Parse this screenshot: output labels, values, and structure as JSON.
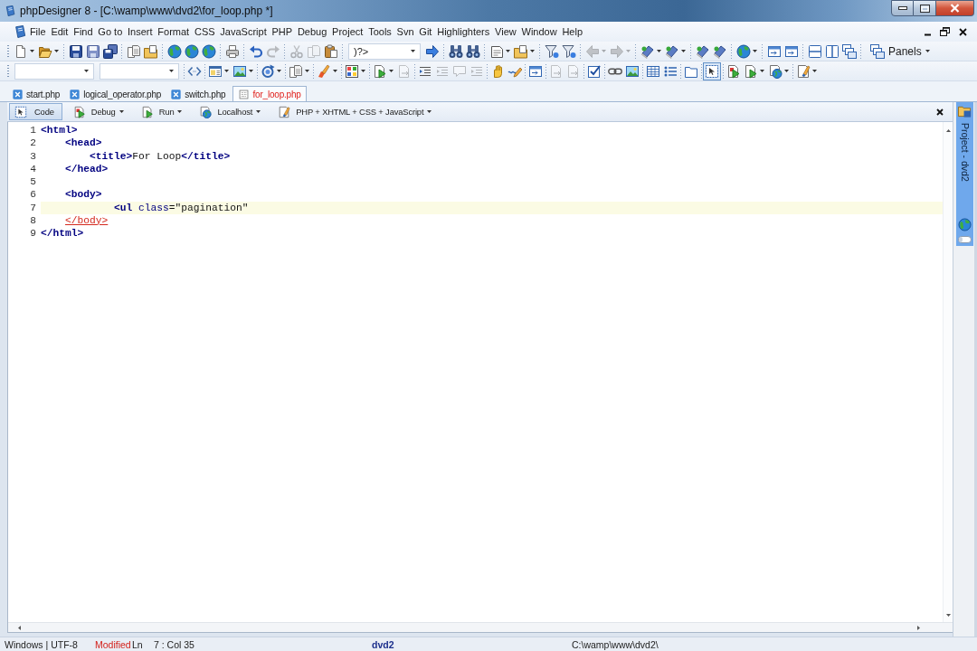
{
  "window": {
    "title": "phpDesigner 8 - [C:\\wamp\\www\\dvd2\\for_loop.php *]"
  },
  "menu_bar": {
    "items": [
      "File",
      "Edit",
      "Find",
      "Go to",
      "Insert",
      "Format",
      "CSS",
      "JavaScript",
      "PHP",
      "Debug",
      "Project",
      "Tools",
      "Svn",
      "Git",
      "Highlighters",
      "View",
      "Window",
      "Help"
    ]
  },
  "toolbar_1": [
    {
      "kind": "new",
      "menu": true,
      "disabled": false
    },
    {
      "kind": "open",
      "menu": true,
      "disabled": false
    },
    {
      "kind": "separator"
    },
    {
      "kind": "save",
      "menu": false,
      "disabled": false
    },
    {
      "kind": "savecopy",
      "menu": false,
      "disabled": false
    },
    {
      "kind": "saveall",
      "menu": false,
      "disabled": false
    },
    {
      "kind": "separator"
    },
    {
      "kind": "pages",
      "menu": false,
      "disabled": false
    },
    {
      "kind": "folderpage",
      "menu": false,
      "disabled": false
    },
    {
      "kind": "separator"
    },
    {
      "kind": "globe",
      "menu": false,
      "disabled": false
    },
    {
      "kind": "globe",
      "menu": false,
      "disabled": false
    },
    {
      "kind": "globe",
      "menu": false,
      "disabled": false
    },
    {
      "kind": "separator"
    },
    {
      "kind": "print",
      "menu": false,
      "disabled": false
    },
    {
      "kind": "separator"
    },
    {
      "kind": "undo",
      "menu": false,
      "disabled": false
    },
    {
      "kind": "redo",
      "menu": false,
      "disabled": true
    },
    {
      "kind": "separator"
    },
    {
      "kind": "cut",
      "menu": false,
      "disabled": true
    },
    {
      "kind": "copy",
      "menu": false,
      "disabled": true
    },
    {
      "kind": "paste",
      "menu": false,
      "disabled": false
    },
    {
      "kind": "separator"
    },
    {
      "kind": "combo",
      "value": ")?>"
    },
    {
      "kind": "arrow",
      "menu": false,
      "disabled": false
    },
    {
      "kind": "separator"
    },
    {
      "kind": "binoculars",
      "menu": false,
      "disabled": false
    },
    {
      "kind": "binoculars",
      "menu": false,
      "disabled": false
    },
    {
      "kind": "separator"
    },
    {
      "kind": "note",
      "menu": true,
      "disabled": false
    },
    {
      "kind": "folderpage",
      "menu": true,
      "disabled": false
    },
    {
      "kind": "separator"
    },
    {
      "kind": "filter",
      "menu": false,
      "disabled": false
    },
    {
      "kind": "filter",
      "menu": false,
      "disabled": false
    },
    {
      "kind": "separator"
    },
    {
      "kind": "back",
      "menu": true,
      "disabled": true
    },
    {
      "kind": "forward",
      "menu": true,
      "disabled": true
    },
    {
      "kind": "separator"
    },
    {
      "kind": "bookmark",
      "menu": true,
      "disabled": false
    },
    {
      "kind": "bookmark",
      "menu": true,
      "disabled": false
    },
    {
      "kind": "separator"
    },
    {
      "kind": "bookmark",
      "menu": false,
      "disabled": false
    },
    {
      "kind": "bookmark",
      "menu": false,
      "disabled": false
    },
    {
      "kind": "separator"
    },
    {
      "kind": "globe",
      "menu": true,
      "disabled": false
    },
    {
      "kind": "separator"
    },
    {
      "kind": "window",
      "menu": false,
      "disabled": false
    },
    {
      "kind": "window",
      "menu": false,
      "disabled": false
    },
    {
      "kind": "separator"
    },
    {
      "kind": "rows",
      "menu": false,
      "disabled": false
    },
    {
      "kind": "columns",
      "menu": false,
      "disabled": false
    },
    {
      "kind": "cascade",
      "menu": false,
      "disabled": false
    },
    {
      "kind": "separator"
    },
    {
      "kind": "panels",
      "label": "Panels",
      "menu": true,
      "disabled": false
    }
  ],
  "toolbar_2": [
    {
      "kind": "combo"
    },
    {
      "kind": "combo"
    },
    {
      "kind": "separator"
    },
    {
      "kind": "tag",
      "menu": false,
      "disabled": false,
      "pressed": false
    },
    {
      "kind": "separator"
    },
    {
      "kind": "calendar",
      "menu": true,
      "disabled": false,
      "pressed": false
    },
    {
      "kind": "image",
      "menu": true,
      "disabled": false,
      "pressed": false
    },
    {
      "kind": "separator"
    },
    {
      "kind": "refresh",
      "menu": true,
      "disabled": false,
      "pressed": false
    },
    {
      "kind": "separator"
    },
    {
      "kind": "pages",
      "menu": true,
      "disabled": false,
      "pressed": false
    },
    {
      "kind": "separator"
    },
    {
      "kind": "brush",
      "menu": true,
      "disabled": false,
      "pressed": false
    },
    {
      "kind": "separator"
    },
    {
      "kind": "grid",
      "menu": true,
      "disabled": false,
      "pressed": false
    },
    {
      "kind": "separator"
    },
    {
      "kind": "run",
      "menu": true,
      "disabled": false,
      "pressed": false
    },
    {
      "kind": "step",
      "menu": false,
      "disabled": true,
      "pressed": false
    },
    {
      "kind": "separator"
    },
    {
      "kind": "indent",
      "menu": false,
      "disabled": false,
      "pressed": false
    },
    {
      "kind": "indent",
      "menu": false,
      "disabled": true,
      "pressed": false
    },
    {
      "kind": "comment",
      "menu": false,
      "disabled": true,
      "pressed": false
    },
    {
      "kind": "indent",
      "menu": false,
      "disabled": true,
      "pressed": false
    },
    {
      "kind": "separator"
    },
    {
      "kind": "hand",
      "menu": false,
      "disabled": false,
      "pressed": false
    },
    {
      "kind": "pen",
      "menu": false,
      "disabled": false,
      "pressed": false
    },
    {
      "kind": "separator"
    },
    {
      "kind": "window",
      "menu": false,
      "disabled": false,
      "pressed": false
    },
    {
      "kind": "separator"
    },
    {
      "kind": "step",
      "menu": false,
      "disabled": true,
      "pressed": false
    },
    {
      "kind": "step",
      "menu": false,
      "disabled": true,
      "pressed": false
    },
    {
      "kind": "separator"
    },
    {
      "kind": "check",
      "menu": false,
      "disabled": false,
      "pressed": false
    },
    {
      "kind": "separator"
    },
    {
      "kind": "link",
      "menu": false,
      "disabled": false,
      "pressed": false
    },
    {
      "kind": "image",
      "menu": false,
      "disabled": false,
      "pressed": false
    },
    {
      "kind": "separator"
    },
    {
      "kind": "table",
      "menu": false,
      "disabled": false,
      "pressed": false
    },
    {
      "kind": "list",
      "menu": false,
      "disabled": false,
      "pressed": false
    },
    {
      "kind": "separator"
    },
    {
      "kind": "folder",
      "menu": false,
      "disabled": false,
      "pressed": false
    },
    {
      "kind": "separator"
    },
    {
      "kind": "select",
      "menu": false,
      "disabled": false,
      "pressed": true
    },
    {
      "kind": "separator"
    },
    {
      "kind": "runred",
      "menu": false,
      "disabled": false,
      "pressed": false
    },
    {
      "kind": "run",
      "menu": true,
      "disabled": false,
      "pressed": false
    },
    {
      "kind": "globedoc",
      "menu": true,
      "disabled": false,
      "pressed": false
    },
    {
      "kind": "separator"
    },
    {
      "kind": "brushdoc",
      "menu": true,
      "disabled": false,
      "pressed": false
    }
  ],
  "tabs": [
    {
      "label": "start.php",
      "selected": false
    },
    {
      "label": "logical_operator.php",
      "selected": false
    },
    {
      "label": "switch.php",
      "selected": false
    },
    {
      "label": "for_loop.php",
      "selected": true
    }
  ],
  "view_bar": {
    "buttons": [
      {
        "kind": "select",
        "label": "Code",
        "selected": true,
        "menu": false
      },
      {
        "kind": "runred",
        "label": "Debug",
        "selected": false,
        "menu": true
      },
      {
        "kind": "run",
        "label": "Run",
        "selected": false,
        "menu": true
      },
      {
        "kind": "globedoc",
        "label": "Localhost",
        "selected": false,
        "menu": true
      },
      {
        "kind": "brushdoc",
        "label": "PHP + XHTML + CSS + JavaScript",
        "selected": false,
        "menu": true
      }
    ]
  },
  "editor": {
    "lines": [
      {
        "number": "1",
        "current": false,
        "tokens": [
          {
            "kind": "tag",
            "text": "<html>"
          }
        ]
      },
      {
        "number": "2",
        "current": false,
        "tokens": [
          {
            "kind": "tag",
            "text": "    <head>"
          }
        ]
      },
      {
        "number": "3",
        "current": false,
        "tokens": [
          {
            "kind": "tag",
            "text": "        <title>"
          },
          {
            "kind": "text",
            "text": "For Loop"
          },
          {
            "kind": "tag",
            "text": "</title>"
          }
        ]
      },
      {
        "number": "4",
        "current": false,
        "tokens": [
          {
            "kind": "tag",
            "text": "    </head>"
          }
        ]
      },
      {
        "number": "5",
        "current": false
      },
      {
        "number": "6",
        "current": false,
        "tokens": [
          {
            "kind": "tag",
            "text": "    <body>"
          }
        ]
      },
      {
        "number": "7",
        "current": true,
        "tokens": [
          {
            "kind": "tag",
            "text": "            <ul"
          },
          {
            "kind": "attr",
            "text": " class"
          },
          {
            "kind": "string",
            "text": "=\"pagination\""
          }
        ]
      },
      {
        "number": "8",
        "current": false,
        "tokens": [
          {
            "kind": "error",
            "text": "    </body>"
          }
        ]
      },
      {
        "number": "9",
        "current": false,
        "tokens": [
          {
            "kind": "tag",
            "text": "</html>"
          }
        ]
      }
    ]
  },
  "side_dock": {
    "label": "Project - dvd2"
  },
  "status_bar": {
    "encoding": "Windows | UTF-8",
    "modified": "Modified",
    "line_label": "Ln",
    "position": "7 : Col 35",
    "project": "dvd2",
    "path": "C:\\wamp\\www\\dvd2\\"
  }
}
